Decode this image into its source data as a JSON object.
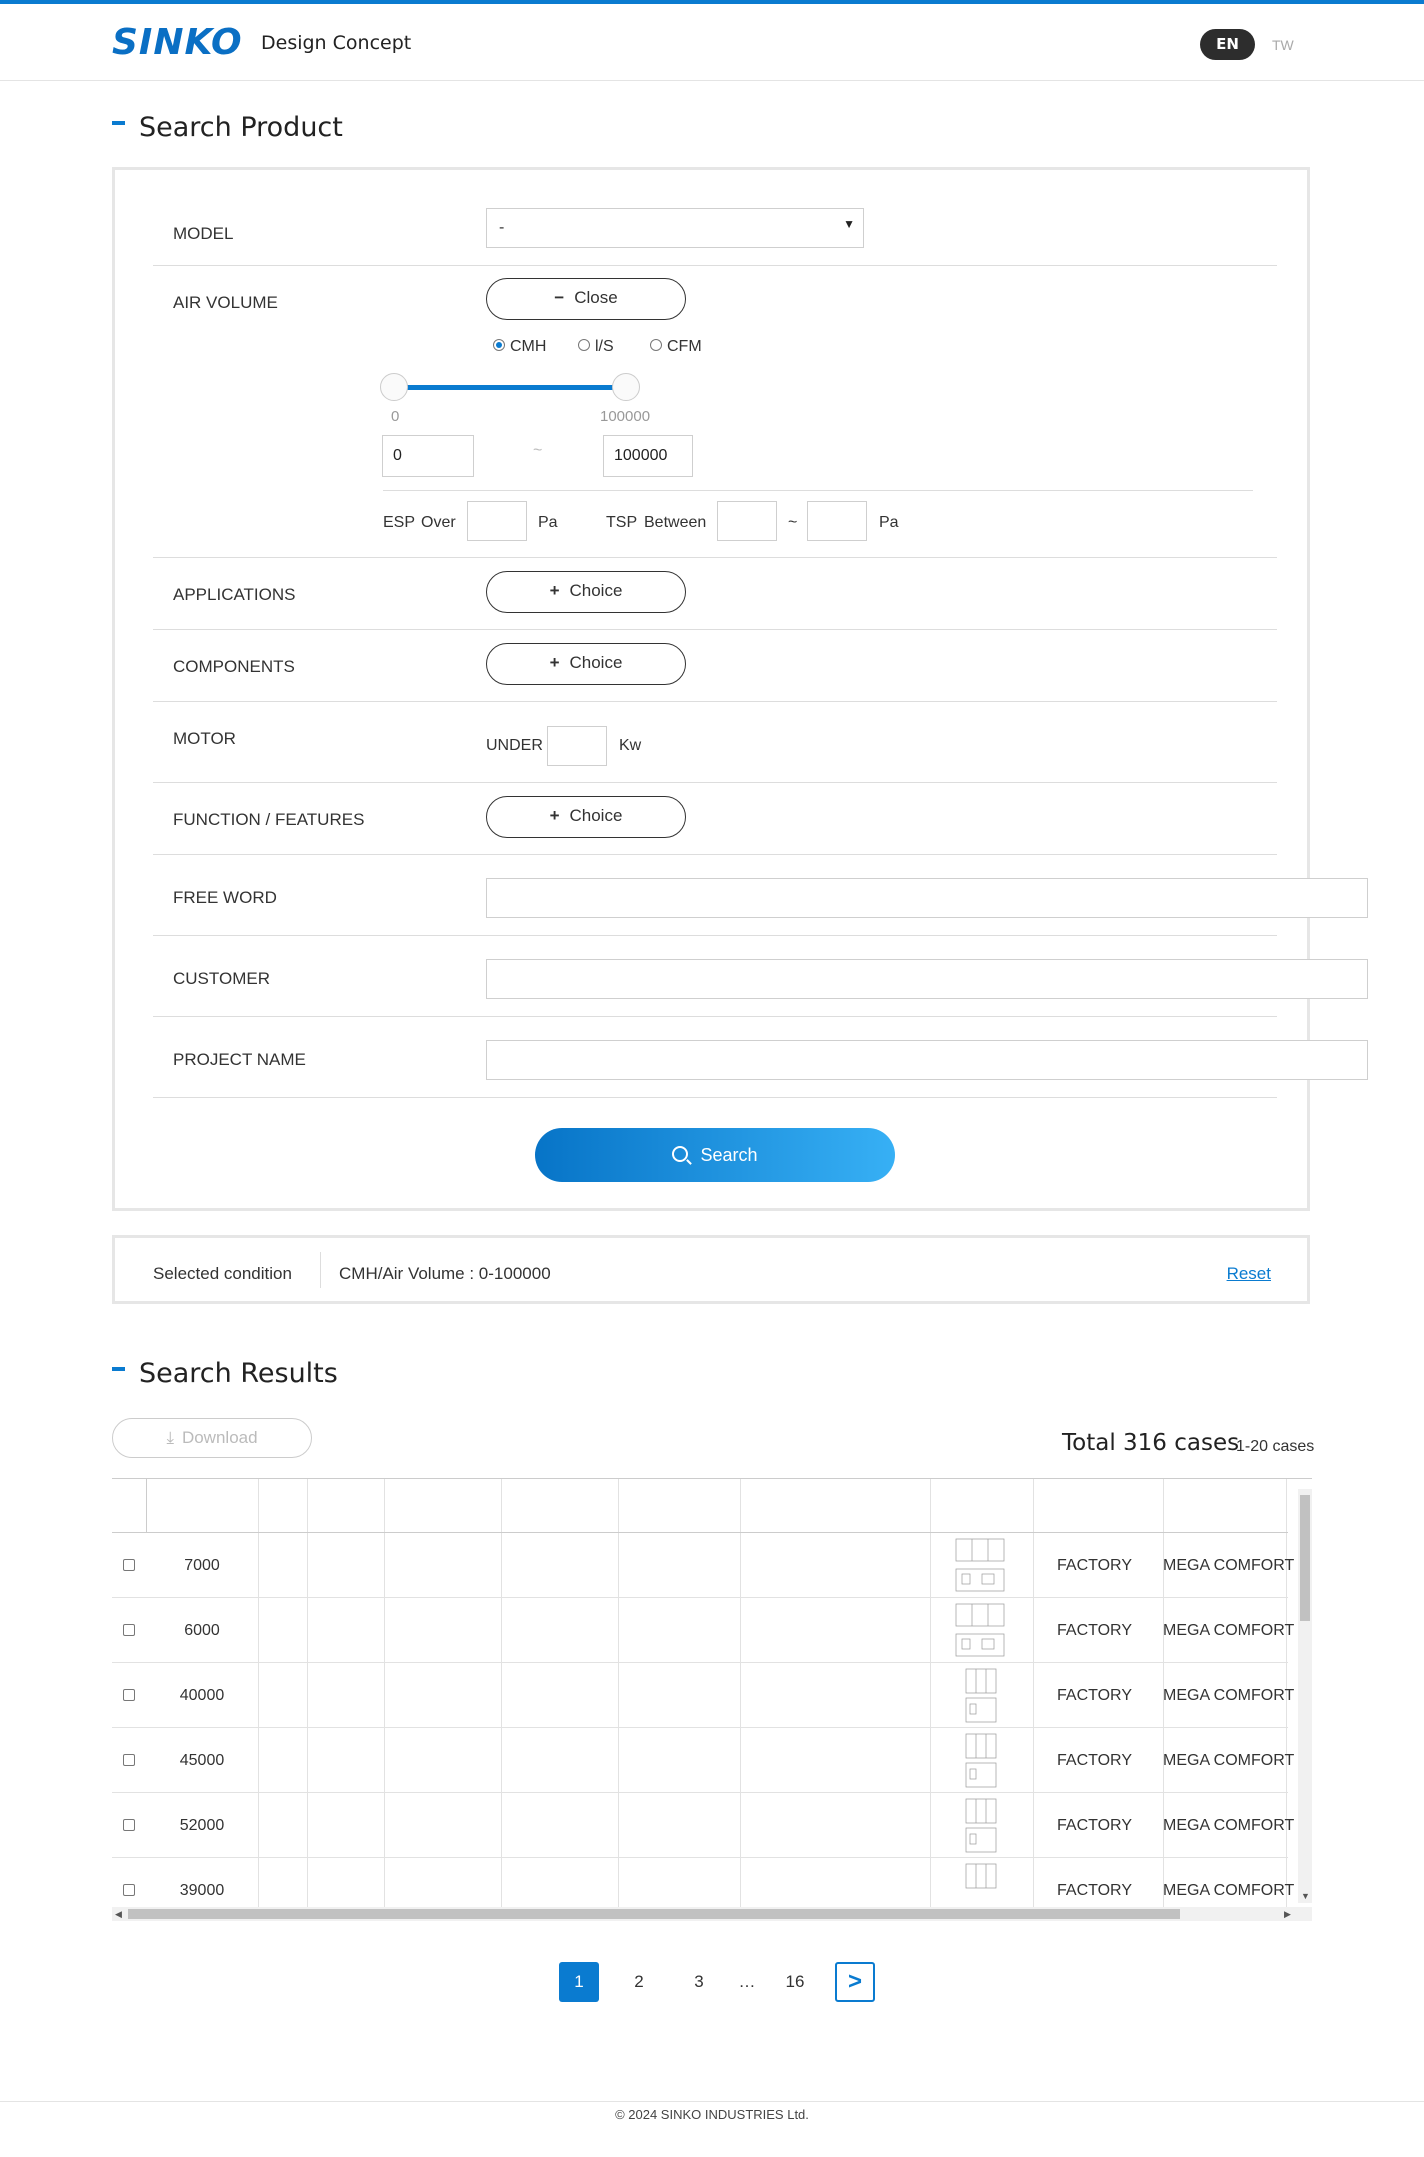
{
  "header": {
    "logo": "SINKO",
    "tagline": "Design Concept",
    "lang_active": "EN",
    "lang_other": "TW"
  },
  "search": {
    "title": "Search Product",
    "model": {
      "label": "MODEL",
      "value": "-"
    },
    "air_volume": {
      "label": "AIR VOLUME",
      "toggle": "Close",
      "units": [
        "CMH",
        "l/S",
        "CFM"
      ],
      "selected_unit": "CMH",
      "slider_min_label": "0",
      "slider_max_label": "100000",
      "min_value": "0",
      "max_value": "100000",
      "tilde": "~",
      "esp_label": "ESP",
      "over_label": "Over",
      "pa1": "Pa",
      "tsp_label": "TSP",
      "between_label": "Between",
      "tilde2": "~",
      "pa2": "Pa"
    },
    "applications": {
      "label": "APPLICATIONS",
      "button": "Choice"
    },
    "components": {
      "label": "COMPONENTS",
      "button": "Choice"
    },
    "motor": {
      "label": "MOTOR",
      "under": "UNDER",
      "unit": "Kw"
    },
    "features": {
      "label": "FUNCTION / FEATURES",
      "button": "Choice"
    },
    "free_word": {
      "label": "FREE WORD",
      "value": ""
    },
    "customer": {
      "label": "CUSTOMER",
      "value": ""
    },
    "project": {
      "label": "PROJECT NAME",
      "value": ""
    },
    "search_button": "Search"
  },
  "condition": {
    "label": "Selected condition",
    "value": "CMH/Air Volume : 0-100000",
    "reset": "Reset"
  },
  "results": {
    "title": "Search Results",
    "download": "Download",
    "total": "Total 316 cases",
    "range": "1-20 cases",
    "rows": [
      {
        "air": "7000",
        "application": "FACTORY",
        "system": "MEGA COMFORT"
      },
      {
        "air": "6000",
        "application": "FACTORY",
        "system": "MEGA COMFORT"
      },
      {
        "air": "40000",
        "application": "FACTORY",
        "system": "MEGA COMFORT"
      },
      {
        "air": "45000",
        "application": "FACTORY",
        "system": "MEGA COMFORT"
      },
      {
        "air": "52000",
        "application": "FACTORY",
        "system": "MEGA COMFORT"
      },
      {
        "air": "39000",
        "application": "FACTORY",
        "system": "MEGA COMFORT"
      }
    ]
  },
  "pagination": {
    "pages": [
      "1",
      "2",
      "3"
    ],
    "ellipsis": "…",
    "last": "16",
    "current": "1"
  },
  "footer": {
    "copyright": "© 2024 SINKO INDUSTRIES Ltd."
  },
  "colors": {
    "accent": "#0a7bd0",
    "dark": "#2d2d2d"
  }
}
